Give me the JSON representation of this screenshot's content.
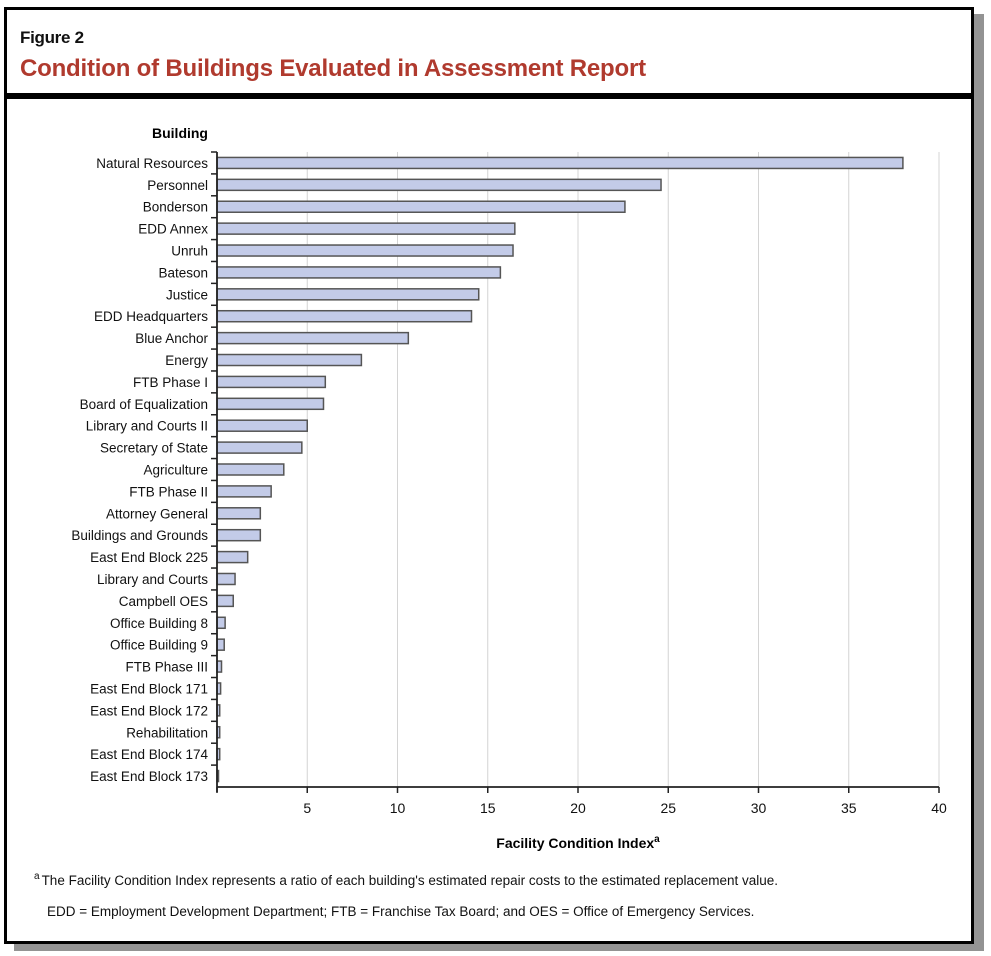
{
  "figure": {
    "label": "Figure 2",
    "title": "Condition of Buildings Evaluated in Assessment Report"
  },
  "chart_data": {
    "type": "bar",
    "orientation": "horizontal",
    "title": "Condition of Buildings Evaluated in Assessment Report",
    "ylabel": "Building",
    "xlabel": "Facility Condition Index",
    "xlabel_superscript": "a",
    "xlim": [
      0,
      40
    ],
    "xticks": [
      5,
      10,
      15,
      20,
      25,
      30,
      35,
      40
    ],
    "grid": true,
    "categories": [
      "Natural Resources",
      "Personnel",
      "Bonderson",
      "EDD Annex",
      "Unruh",
      "Bateson",
      "Justice",
      "EDD Headquarters",
      "Blue Anchor",
      "Energy",
      "FTB Phase I",
      "Board of Equalization",
      "Library and Courts II",
      "Secretary of State",
      "Agriculture",
      "FTB Phase II",
      "Attorney General",
      "Buildings and Grounds",
      "East End Block 225",
      "Library and Courts",
      "Campbell OES",
      "Office Building 8",
      "Office Building 9",
      "FTB Phase III",
      "East End Block 171",
      "East End Block 172",
      "Rehabilitation",
      "East End Block 174",
      "East End Block 173"
    ],
    "values": [
      38.0,
      24.6,
      22.6,
      16.5,
      16.4,
      15.7,
      14.5,
      14.1,
      10.6,
      8.0,
      6.0,
      5.9,
      5.0,
      4.7,
      3.7,
      3.0,
      2.4,
      2.4,
      1.7,
      1.0,
      0.9,
      0.45,
      0.4,
      0.25,
      0.2,
      0.15,
      0.15,
      0.15,
      0.08
    ],
    "bar_color": "#c3cbe8",
    "bar_edge_color": "#555555"
  },
  "footnotes": {
    "marker": "a",
    "note": "The Facility Condition Index represents a ratio of each building's estimated repair costs to the estimated replacement value.",
    "abbreviations": "EDD = Employment Development Department; FTB = Franchise Tax Board; and OES = Office of Emergency Services."
  }
}
